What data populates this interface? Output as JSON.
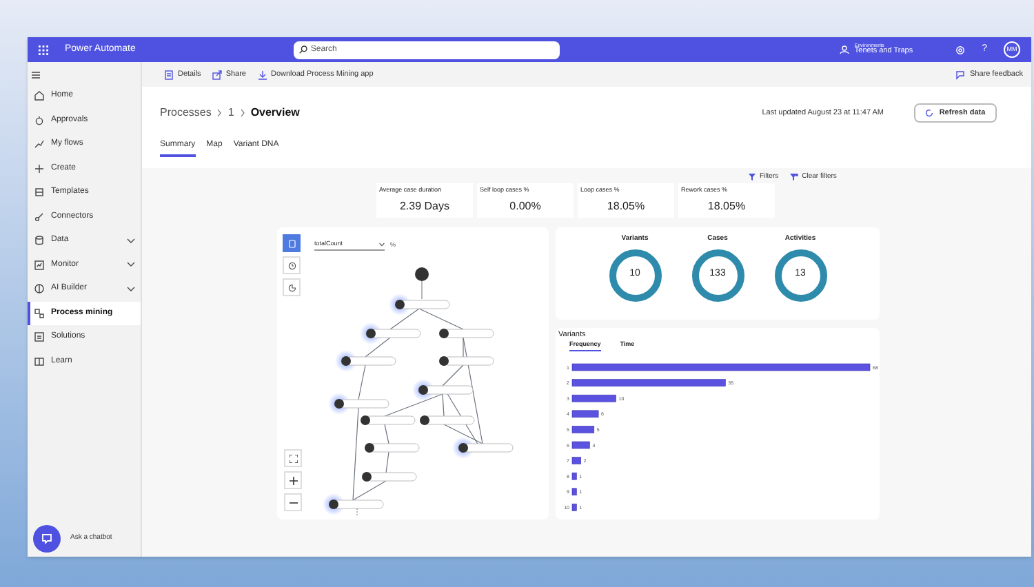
{
  "app": {
    "name": "Power Automate",
    "search": {
      "placeholder": "Search"
    },
    "environment": {
      "caption": "Environments",
      "name": "Tenets and Traps"
    },
    "help": "?",
    "avatar": "MM"
  },
  "sidebar": {
    "items": [
      {
        "label": "Home",
        "selected": false,
        "expandable": false
      },
      {
        "label": "Approvals",
        "selected": false,
        "expandable": false
      },
      {
        "label": "My flows",
        "selected": false,
        "expandable": false
      },
      {
        "label": "Create",
        "selected": false,
        "expandable": false
      },
      {
        "label": "Templates",
        "selected": false,
        "expandable": false
      },
      {
        "label": "Connectors",
        "selected": false,
        "expandable": false
      },
      {
        "label": "Data",
        "selected": false,
        "expandable": true
      },
      {
        "label": "Monitor",
        "selected": false,
        "expandable": true
      },
      {
        "label": "AI Builder",
        "selected": false,
        "expandable": true
      },
      {
        "label": "Process mining",
        "selected": true,
        "expandable": false
      },
      {
        "label": "Solutions",
        "selected": false,
        "expandable": false
      },
      {
        "label": "Learn",
        "selected": false,
        "expandable": false
      }
    ],
    "chatbot": "Ask a chatbot"
  },
  "command_bar": {
    "items": [
      "Details",
      "Share",
      "Download Process Mining app"
    ],
    "feedback": "Share feedback"
  },
  "breadcrumb": [
    "Processes",
    "1",
    "Overview"
  ],
  "last_updated": "Last updated August 23 at 11:47 AM",
  "refresh_button": "Refresh data",
  "tabs": [
    {
      "label": "Summary",
      "selected": true
    },
    {
      "label": "Map",
      "selected": false
    },
    {
      "label": "Variant DNA",
      "selected": false
    }
  ],
  "filters": {
    "filters": "Filters",
    "clear": "Clear filters"
  },
  "kpis": [
    {
      "label": "Average case duration",
      "value": "2.39 Days"
    },
    {
      "label": "Self loop cases %",
      "value": "0.00%"
    },
    {
      "label": "Loop cases %",
      "value": "18.05%"
    },
    {
      "label": "Rework cases %",
      "value": "18.05%"
    }
  ],
  "map": {
    "tools": [
      {
        "selected": true
      },
      {
        "selected": false
      },
      {
        "selected": false
      }
    ],
    "metric": "totalCount",
    "unit": "%"
  },
  "totals": [
    {
      "label": "Variants",
      "value": "10"
    },
    {
      "label": "Cases",
      "value": "133"
    },
    {
      "label": "Activities",
      "value": "13"
    }
  ],
  "variants": {
    "title": "Variants",
    "tabs": [
      {
        "label": "Frequency",
        "selected": true
      },
      {
        "label": "Time",
        "selected": false
      }
    ],
    "chart_data": {
      "type": "bar",
      "orientation": "horizontal",
      "data_labels": true,
      "categories": [
        "1",
        "2",
        "3",
        "4",
        "5",
        "6",
        "7",
        "8",
        "9",
        "10"
      ],
      "values": [
        68,
        35,
        10,
        6,
        5,
        4,
        2,
        1,
        1,
        1
      ]
    }
  }
}
